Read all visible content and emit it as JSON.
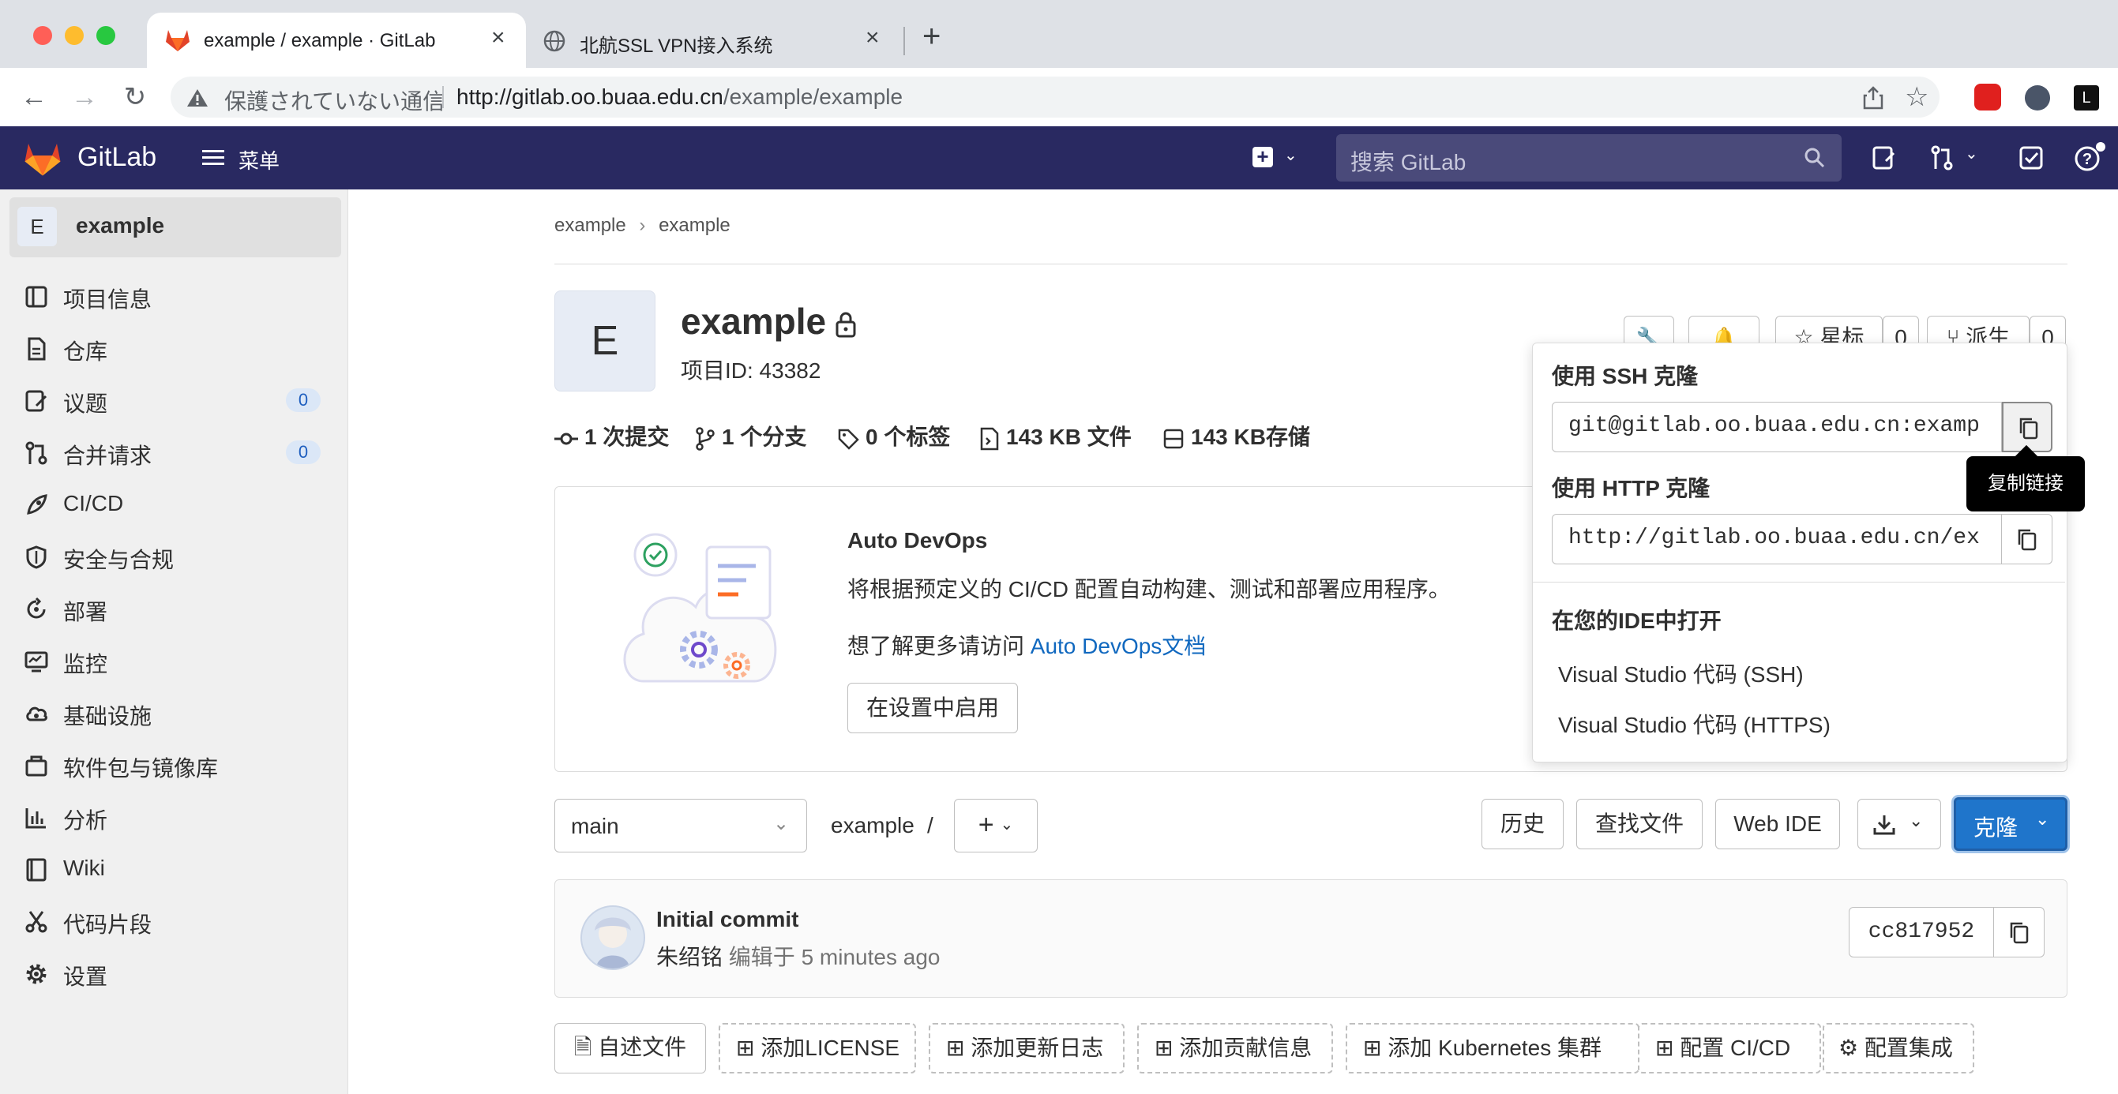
{
  "browser": {
    "tabs": [
      {
        "title": "example / example · GitLab",
        "active": true
      },
      {
        "title": "北航SSL VPN接入系统",
        "active": false
      }
    ],
    "new_tab": "+",
    "security_label": "保護されていない通信",
    "url_host": "http://gitlab.oo.buaa.edu.cn",
    "url_path": "/example/example"
  },
  "gitlab_nav": {
    "brand": "GitLab",
    "menu_label": "菜单",
    "search_placeholder": "搜索 GitLab"
  },
  "sidebar": {
    "project_letter": "E",
    "project_name": "example",
    "items": [
      {
        "label": "项目信息",
        "icon": "info-icon"
      },
      {
        "label": "仓库",
        "icon": "repository-icon"
      },
      {
        "label": "议题",
        "icon": "issues-icon",
        "count": "0"
      },
      {
        "label": "合并请求",
        "icon": "merge-request-icon",
        "count": "0"
      },
      {
        "label": "CI/CD",
        "icon": "rocket-icon"
      },
      {
        "label": "安全与合规",
        "icon": "shield-icon"
      },
      {
        "label": "部署",
        "icon": "deploy-icon"
      },
      {
        "label": "监控",
        "icon": "monitor-icon"
      },
      {
        "label": "基础设施",
        "icon": "cloud-icon"
      },
      {
        "label": "软件包与镜像库",
        "icon": "package-icon"
      },
      {
        "label": "分析",
        "icon": "chart-icon"
      },
      {
        "label": "Wiki",
        "icon": "book-icon"
      },
      {
        "label": "代码片段",
        "icon": "scissors-icon"
      },
      {
        "label": "设置",
        "icon": "gear-icon"
      }
    ]
  },
  "breadcrumb": [
    "example",
    "›",
    "example"
  ],
  "project": {
    "avatar_letter": "E",
    "name": "example",
    "id_label": "项目ID: 43382",
    "star_label": "星标",
    "star_count": "0",
    "fork_label": "派生",
    "fork_count": "0"
  },
  "stats": [
    "1 次提交",
    "1 个分支",
    "0 个标签",
    "143 KB 文件",
    "143 KB存储"
  ],
  "devops": {
    "title": "Auto DevOps",
    "desc": "将根据预定义的 CI/CD 配置自动构建、测试和部署应用程序。",
    "more_prefix": "想了解更多请访问 ",
    "more_link": "Auto DevOps文档",
    "enable_button": "在设置中启用"
  },
  "repo_bar": {
    "branch": "main",
    "path": "example",
    "separator": "/",
    "history": "历史",
    "find_file": "查找文件",
    "web_ide": "Web IDE",
    "clone": "克隆"
  },
  "commit": {
    "title": "Initial commit",
    "author": "朱绍铭",
    "meta": "编辑于 5 minutes ago",
    "sha": "cc817952"
  },
  "actions": [
    "自述文件",
    "添加LICENSE",
    "添加更新日志",
    "添加贡献信息",
    "添加 Kubernetes 集群",
    "配置 CI/CD",
    "配置集成"
  ],
  "clone_dropdown": {
    "ssh_title": "使用 SSH 克隆",
    "ssh_url": "git@gitlab.oo.buaa.edu.cn:examp",
    "http_title": "使用 HTTP 克隆",
    "http_url": "http://gitlab.oo.buaa.edu.cn/ex",
    "ide_title": "在您的IDE中打开",
    "ide_items": [
      "Visual Studio 代码 (SSH)",
      "Visual Studio 代码 (HTTPS)"
    ],
    "tooltip": "复制链接"
  },
  "colors": {
    "gitlab_nav": "#292961",
    "primary_blue": "#1f75cb",
    "link": "#1068bf"
  }
}
